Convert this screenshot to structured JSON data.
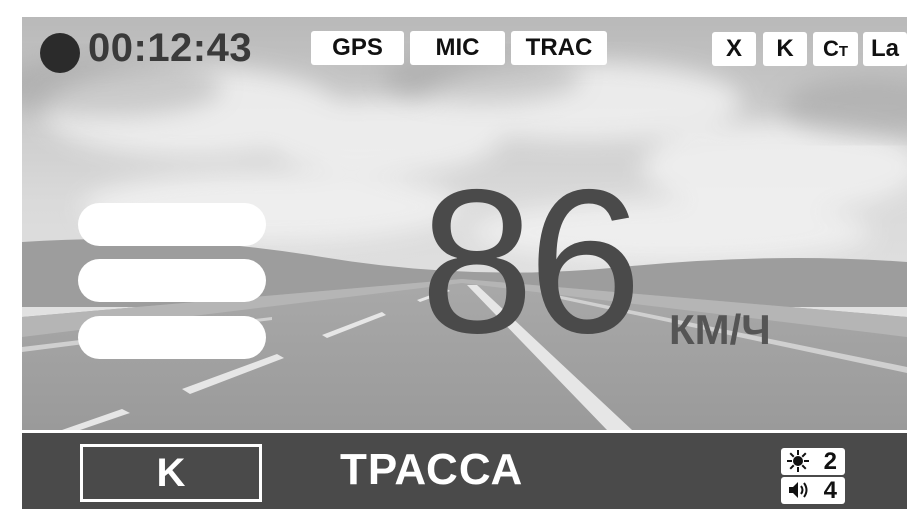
{
  "status": {
    "timer": "00:12:43",
    "tags": [
      "GPS",
      "MIC",
      "TRAC"
    ],
    "bands": [
      "X",
      "K",
      "C",
      "T",
      "La"
    ]
  },
  "speed": {
    "value": "86",
    "unit": "КМ/Ч"
  },
  "signal": {
    "bars": 3
  },
  "bottom": {
    "band": "K",
    "mode": "ТРАССА",
    "brightness": "2",
    "volume": "4"
  },
  "icons": [
    "record-dot-icon",
    "brightness-icon",
    "speaker-icon"
  ]
}
